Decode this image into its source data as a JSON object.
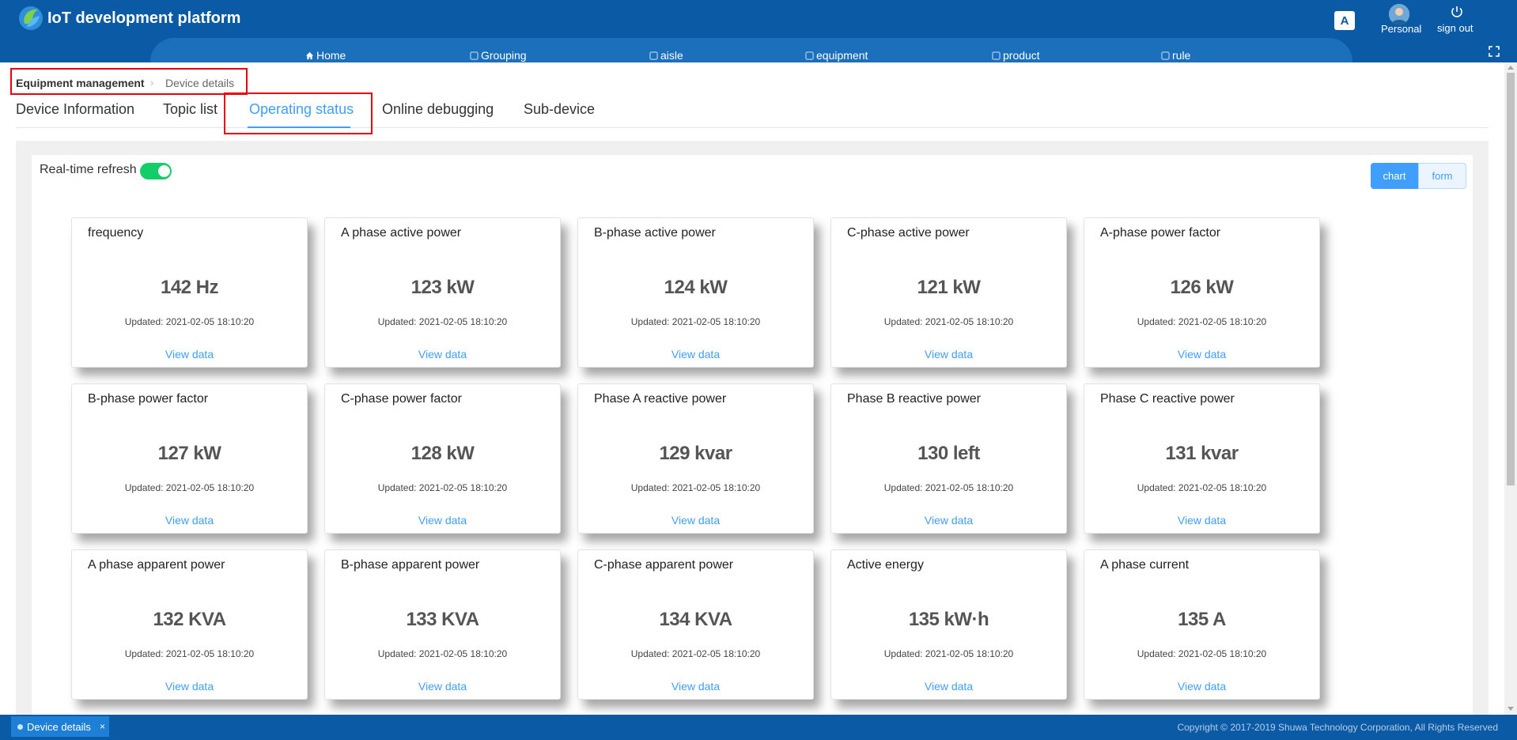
{
  "app": {
    "title": "IoT development platform"
  },
  "nav": [
    {
      "label": "Home",
      "icon": "home-icon"
    },
    {
      "label": "Grouping",
      "icon": "grouping-icon"
    },
    {
      "label": "aisle",
      "icon": "aisle-icon"
    },
    {
      "label": "equipment",
      "icon": "equipment-icon"
    },
    {
      "label": "product",
      "icon": "product-icon"
    },
    {
      "label": "rule",
      "icon": "rule-icon"
    }
  ],
  "header": {
    "translate_glyph": "A",
    "personal_label": "Personal",
    "signout_label": "sign out"
  },
  "breadcrumb": {
    "parent": "Equipment management",
    "current": "Device details",
    "separator": "›"
  },
  "tabs": [
    {
      "label": "Device Information",
      "active": false
    },
    {
      "label": "Topic list",
      "active": false
    },
    {
      "label": "Operating status",
      "active": true
    },
    {
      "label": "Online debugging",
      "active": false
    },
    {
      "label": "Sub-device",
      "active": false
    }
  ],
  "realtime": {
    "label": "Real-time refresh",
    "enabled": true
  },
  "view_toggle": {
    "chart_label": "chart",
    "form_label": "form",
    "selected": "chart"
  },
  "cards": [
    {
      "title": "frequency",
      "value": "142 Hz",
      "updated": "Updated: 2021-02-05 18:10:20",
      "link": "View data"
    },
    {
      "title": "A phase active power",
      "value": "123 kW",
      "updated": "Updated: 2021-02-05 18:10:20",
      "link": "View data"
    },
    {
      "title": "B-phase active power",
      "value": "124 kW",
      "updated": "Updated: 2021-02-05 18:10:20",
      "link": "View data"
    },
    {
      "title": "C-phase active power",
      "value": "121 kW",
      "updated": "Updated: 2021-02-05 18:10:20",
      "link": "View data"
    },
    {
      "title": "A-phase power factor",
      "value": "126 kW",
      "updated": "Updated: 2021-02-05 18:10:20",
      "link": "View data"
    },
    {
      "title": "B-phase power factor",
      "value": "127 kW",
      "updated": "Updated: 2021-02-05 18:10:20",
      "link": "View data"
    },
    {
      "title": "C-phase power factor",
      "value": "128 kW",
      "updated": "Updated: 2021-02-05 18:10:20",
      "link": "View data"
    },
    {
      "title": "Phase A reactive power",
      "value": "129 kvar",
      "updated": "Updated: 2021-02-05 18:10:20",
      "link": "View data"
    },
    {
      "title": "Phase B reactive power",
      "value": "130 left",
      "updated": "Updated: 2021-02-05 18:10:20",
      "link": "View data"
    },
    {
      "title": "Phase C reactive power",
      "value": "131 kvar",
      "updated": "Updated: 2021-02-05 18:10:20",
      "link": "View data"
    },
    {
      "title": "A phase apparent power",
      "value": "132 KVA",
      "updated": "Updated: 2021-02-05 18:10:20",
      "link": "View data"
    },
    {
      "title": "B-phase apparent power",
      "value": "133 KVA",
      "updated": "Updated: 2021-02-05 18:10:20",
      "link": "View data"
    },
    {
      "title": "C-phase apparent power",
      "value": "134 KVA",
      "updated": "Updated: 2021-02-05 18:10:20",
      "link": "View data"
    },
    {
      "title": "Active energy",
      "value": "135 kW·h",
      "updated": "Updated: 2021-02-05 18:10:20",
      "link": "View data"
    },
    {
      "title": "A phase current",
      "value": "135 A",
      "updated": "Updated: 2021-02-05 18:10:20",
      "link": "View data"
    }
  ],
  "footer": {
    "tab_label": "Device details",
    "tab_close": "×",
    "copyright": "Copyright © 2017-2019 Shuwa Technology Corporation, All Rights Reserved"
  },
  "colors": {
    "header_blue": "#0a5aa5",
    "accent": "#409eff",
    "toggle_green": "#13ce66",
    "highlight_red": "#e8000f"
  }
}
